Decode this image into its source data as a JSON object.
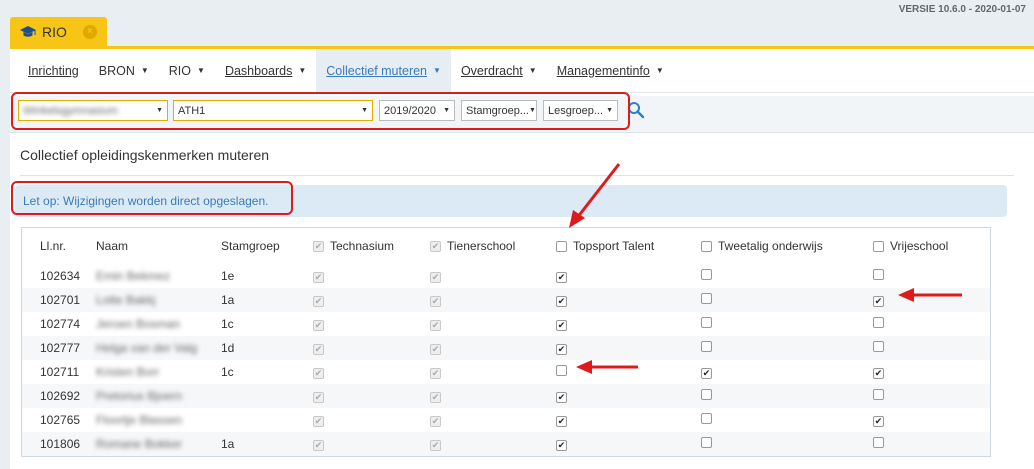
{
  "version": "VERSIE 10.6.0 - 2020-01-07",
  "app_tab": {
    "label": "RIO",
    "close": "×"
  },
  "menu": [
    {
      "label": "Inrichting",
      "caret": false,
      "active": false
    },
    {
      "label": "BRON",
      "caret": true,
      "active": false
    },
    {
      "label": "RIO",
      "caret": true,
      "active": false
    },
    {
      "label": "Dashboards",
      "caret": true,
      "active": false
    },
    {
      "label": "Collectief muteren",
      "caret": true,
      "active": true
    },
    {
      "label": "Overdracht",
      "caret": true,
      "active": false
    },
    {
      "label": "Managementinfo",
      "caret": true,
      "active": false
    }
  ],
  "filters": {
    "school": "Winkelsgymnasium",
    "opleiding": "ATH1",
    "schooljaar": "2019/2020",
    "stamgroep": "Stamgroep...",
    "lesgroep": "Lesgroep..."
  },
  "title": "Collectief opleidingskenmerken muteren",
  "alert": "Let op: Wijzigingen worden direct opgeslagen.",
  "columns": {
    "nr": "Ll.nr.",
    "naam": "Naam",
    "stamgroep": "Stamgroep",
    "technasium": "Technasium",
    "tienerschool": "Tienerschool",
    "topsport": "Topsport Talent",
    "tweetalig": "Tweetalig onderwijs",
    "vrijeschool": "Vrijeschool"
  },
  "header_checks": {
    "technasium": true,
    "tienerschool": true,
    "topsport": false,
    "tweetalig": false,
    "vrijeschool": false
  },
  "rows": [
    {
      "nr": "102634",
      "naam": "Emin Bekmez",
      "stam": "1e",
      "tech": true,
      "tien": true,
      "top": true,
      "twee": false,
      "vrij": false
    },
    {
      "nr": "102701",
      "naam": "Lotte Bakkj",
      "stam": "1a",
      "tech": true,
      "tien": true,
      "top": true,
      "twee": false,
      "vrij": true
    },
    {
      "nr": "102774",
      "naam": "Jeroen Bosman",
      "stam": "1c",
      "tech": true,
      "tien": true,
      "top": true,
      "twee": false,
      "vrij": false
    },
    {
      "nr": "102777",
      "naam": "Helga van der Valg",
      "stam": "1d",
      "tech": true,
      "tien": true,
      "top": true,
      "twee": false,
      "vrij": false
    },
    {
      "nr": "102711",
      "naam": "Kristen Borr",
      "stam": "1c",
      "tech": true,
      "tien": true,
      "top": false,
      "twee": true,
      "vrij": true
    },
    {
      "nr": "102692",
      "naam": "Pretorius Bjoern",
      "stam": "",
      "tech": true,
      "tien": true,
      "top": true,
      "twee": false,
      "vrij": false
    },
    {
      "nr": "102765",
      "naam": "Floortje Blassen",
      "stam": "",
      "tech": true,
      "tien": true,
      "top": true,
      "twee": false,
      "vrij": true
    },
    {
      "nr": "101806",
      "naam": "Romane Bokker",
      "stam": "1a",
      "tech": true,
      "tien": true,
      "top": true,
      "twee": false,
      "vrij": false
    }
  ],
  "colors": {
    "accent": "#f7c515",
    "link": "#3a7ab8",
    "annotation": "#e01a1a"
  }
}
